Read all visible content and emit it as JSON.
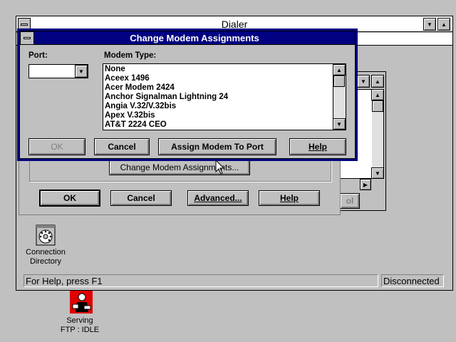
{
  "dialer": {
    "title": "Dialer",
    "status_text": "For Help, press F1",
    "status_right": "Disconnected",
    "buttons": {
      "change_modem": "Change Modem Assignments...",
      "ok": "OK",
      "cancel": "Cancel",
      "advanced": "Advanced...",
      "help": "Help",
      "partial_button": "ol"
    }
  },
  "modal": {
    "title": "Change Modem Assignments",
    "port_label": "Port:",
    "port_value": "",
    "modem_type_label": "Modem Type:",
    "modem_types": [
      "None",
      "Aceex 1496",
      "Acer Modem 2424",
      "Anchor Signalman Lightning 24",
      "Angia V.32/V.32bis",
      "Apex V.32bis",
      "AT&T 2224 CEO"
    ],
    "buttons": {
      "ok": "OK",
      "cancel": "Cancel",
      "assign": "Assign Modem To Port",
      "help": "Help"
    }
  },
  "desktop_icons": [
    {
      "label": "Connection Directory",
      "icon": "phone-dial-icon"
    },
    {
      "label": "Serving FTP : IDLE",
      "icon": "ftp-server-icon"
    }
  ]
}
